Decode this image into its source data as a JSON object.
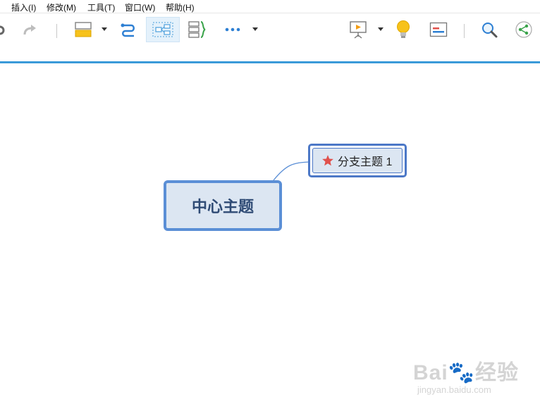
{
  "menu": {
    "items": [
      "插入(I)",
      "修改(M)",
      "工具(T)",
      "窗口(W)",
      "帮助(H)"
    ]
  },
  "toolbar": {
    "icons": [
      "undo-icon",
      "redo-icon",
      "insert-topic-icon",
      "relationship-icon",
      "boundary-icon",
      "summary-icon",
      "more-icon",
      "presentation-icon",
      "idea-icon",
      "gantt-icon",
      "search-icon",
      "share-icon"
    ]
  },
  "colors": {
    "accent": "#3a9ad9",
    "topic_fill": "#dce6f2",
    "topic_border": "#5b8fd6",
    "star": "#e0514c"
  },
  "mindmap": {
    "central_topic": "中心主题",
    "branch_topic": "分支主题 1",
    "branch_marker": "star-icon"
  },
  "watermark": {
    "brand": "Bai🐾经验",
    "url": "jingyan.baidu.com"
  }
}
